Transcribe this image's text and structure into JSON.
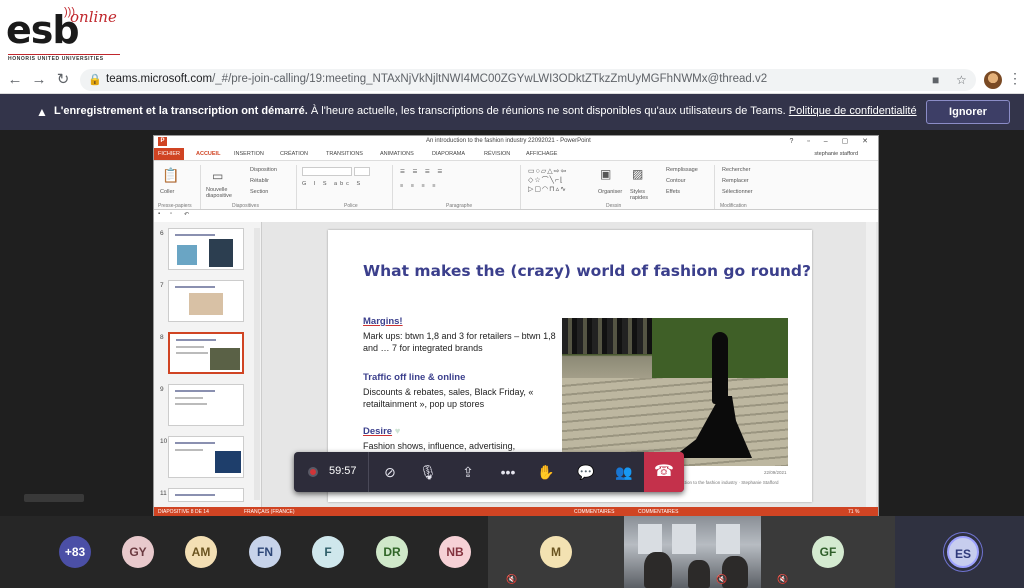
{
  "logo": {
    "text": "esb",
    "online": "online",
    "tagline": "HONORIS UNITED UNIVERSITIES"
  },
  "browser": {
    "url_host": "teams.microsoft.com",
    "url_path": "/_#/pre-join-calling/19:meeting_NTAxNjVkNjltNWI4MC00ZGYwLWI3ODktZTkzZmUyMGFhNWMx@thread.v2"
  },
  "notice": {
    "bold_text": "L'enregistrement et la transcription ont démarré.",
    "text": " À l'heure actuelle, les transcriptions de réunions ne sont disponibles qu'aux utilisateurs de Teams. ",
    "link": "Politique de confidentialité",
    "ignore_label": "Ignorer"
  },
  "ppt": {
    "window_title": "An introduction to the fashion industry 22092021 - PowerPoint",
    "user": "stephanie stafford",
    "tabs": [
      "FICHIER",
      "ACCUEIL",
      "INSERTION",
      "CRÉATION",
      "TRANSITIONS",
      "ANIMATIONS",
      "DIAPORAMA",
      "RÉVISION",
      "AFFICHAGE"
    ],
    "ribbon": {
      "coller": "Coller",
      "nouvelle": "Nouvelle diapositive",
      "disposition": "Disposition",
      "retablir": "Rétablir",
      "section": "Section",
      "organiser": "Organiser",
      "styles": "Styles rapides",
      "remplissage": "Remplissage",
      "contour": "Contour",
      "effets": "Effets",
      "rechercher": "Rechercher",
      "remplacer": "Remplacer",
      "selectionner": "Sélectionner",
      "group_presse": "Presse-papiers",
      "group_diapos": "Diapositives",
      "group_police": "Police",
      "group_para": "Paragraphe",
      "group_dessin": "Dessin",
      "group_modif": "Modification"
    },
    "thumbnails": [
      "6",
      "7",
      "8",
      "9",
      "10",
      "11"
    ],
    "selected_thumbnail": "8",
    "slide": {
      "title": "What makes the (crazy) world of fashion go round?",
      "h1": "Margins!",
      "p1_a": "Mark ups: btwn 1,8 and 3 for retailers – btwn 1,8 and … 7 for integrated brands",
      "h2": "Traffic off line & online",
      "p2": "Discounts & rebates, sales, Black Friday, « retailtainment », pop up stores",
      "h3": "Desire",
      "p3": "Fashion shows, influence, advertising,",
      "footer": "An introduction to the fashion industry · Stephanie Stafford",
      "date": "22/09/2021"
    },
    "status": {
      "slide_info": "DIAPOSITIVE 8 DE 14",
      "language": "FRANÇAIS (FRANCE)",
      "comments1": "COMMENTAIRES",
      "comments2": "COMMENTAIRES",
      "zoom": "71 %"
    }
  },
  "toolbar": {
    "timer": "59:57"
  },
  "participants": [
    {
      "initials": "+83",
      "bg": "#4b4fa6",
      "fg": "#ffffff"
    },
    {
      "initials": "GY",
      "bg": "#e8c9cc",
      "fg": "#6b3a40"
    },
    {
      "initials": "AM",
      "bg": "#f3dfb4",
      "fg": "#6b5420"
    },
    {
      "initials": "FN",
      "bg": "#c7d3ea",
      "fg": "#2d4677"
    },
    {
      "initials": "F",
      "bg": "#cfe7ec",
      "fg": "#2e5e69"
    },
    {
      "initials": "DR",
      "bg": "#cfe8c9",
      "fg": "#2f6526"
    },
    {
      "initials": "NB",
      "bg": "#f6d1d6",
      "fg": "#83323e"
    },
    {
      "initials": "M",
      "bg": "#f3e2b2",
      "fg": "#6a5420"
    },
    {
      "initials": "GF",
      "bg": "#d4ead0",
      "fg": "#2f5f2a"
    },
    {
      "initials": "ES",
      "bg": "#c7cdee",
      "fg": "#2f3a7a"
    }
  ]
}
